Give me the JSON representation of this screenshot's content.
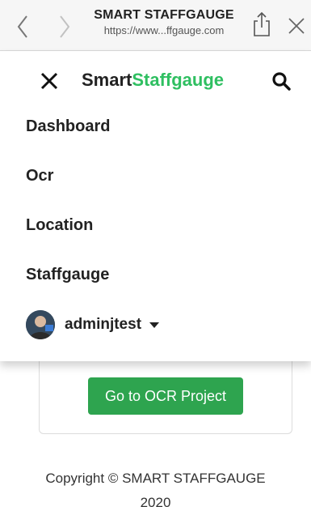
{
  "browser": {
    "site_title": "SMART STAFFGAUGE",
    "url": "https://www...ffgauge.com",
    "icons": [
      "back-icon",
      "forward-icon",
      "share-icon",
      "close-icon"
    ]
  },
  "menu": {
    "brand_part1": "Smart",
    "brand_part2": "Staffgauge",
    "brand_color": "#2fbf61",
    "items": [
      {
        "label": "Dashboard"
      },
      {
        "label": "Ocr"
      },
      {
        "label": "Location"
      },
      {
        "label": "Staffgauge"
      }
    ],
    "user": {
      "name": "adminjtest"
    }
  },
  "main": {
    "cta_label": "Go to OCR Project",
    "cta_color": "#2ea44f"
  },
  "footer": {
    "line1": "Copyright © SMART STAFFGAUGE",
    "line2": "2020"
  }
}
